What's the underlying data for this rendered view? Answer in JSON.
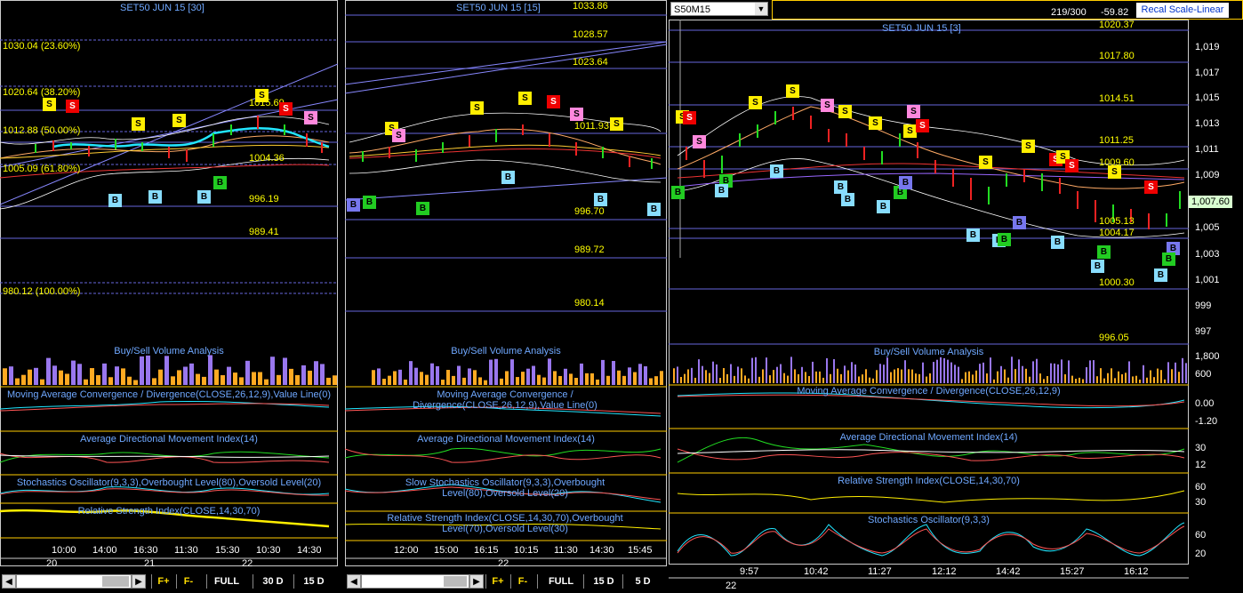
{
  "panels": [
    {
      "title": "SET50 JUN 15  [30]",
      "levels": [
        "1030.04 (23.60%)",
        "1020.64 (38.20%)",
        "1012.88 (50.00%)",
        "1005.09 (61.80%)",
        "980.12 (100.00%)",
        "1015.69",
        "1004.36",
        "996.19",
        "989.41"
      ],
      "indicators": [
        "Buy/Sell Volume Analysis",
        "Moving Average Convergence / Divergence(CLOSE,26,12,9),Value Line(0)",
        "Average Directional Movement Index(14)",
        "Stochastics Oscillator(9,3,3),Overbought Level(80),Oversold Level(20)",
        "Relative Strength Index(CLOSE,14,30,70)"
      ],
      "times": [
        "10:00",
        "14:00",
        "16:30",
        "11:30",
        "15:30",
        "10:30",
        "14:30"
      ],
      "dates": [
        "20",
        "21",
        "22"
      ],
      "buttons": [
        "F+",
        "F-",
        "FULL",
        "30 D",
        "15 D"
      ]
    },
    {
      "title": "SET50 JUN 15  [15]",
      "levels": [
        "1033.86",
        "1028.57",
        "1023.64",
        "1011.93",
        "996.70",
        "989.72",
        "980.14"
      ],
      "indicators": [
        "Buy/Sell Volume Analysis",
        "Moving Average Convergence / Divergence(CLOSE,26,12,9),Value Line(0)",
        "Average Directional Movement Index(14)",
        "Slow Stochastics Oscillator(9,3,3),Overbought Level(80),Oversold Level(20)",
        "Relative Strength Index(CLOSE,14,30,70),Overbought Level(70),Oversold Level(30)"
      ],
      "times": [
        "12:00",
        "15:00",
        "16:15",
        "10:15",
        "11:30",
        "14:30",
        "15:45"
      ],
      "dates": [
        "22"
      ],
      "buttons": [
        "F+",
        "F-",
        "FULL",
        "15 D",
        "5 D"
      ]
    },
    {
      "title": "SET50 JUN 15  [3]",
      "symbol": "S50M15",
      "counter": "219/300",
      "change": "-59.82",
      "scale_button": "Recal Scale-Linear",
      "levels": [
        "1020.37",
        "1017.80",
        "1014.51",
        "1011.25",
        "1009.60",
        "1005.13",
        "1004.17",
        "1000.30",
        "996.05"
      ],
      "last_price": "1,007.60",
      "price_axis": [
        "1,019",
        "1,017",
        "1,015",
        "1,013",
        "1,011",
        "1,009",
        "1,005",
        "1,003",
        "1,001",
        "999",
        "997"
      ],
      "volume_axis": [
        "1,800",
        "600"
      ],
      "macd_axis": [
        "0.00",
        "-1.20"
      ],
      "adx_axis": [
        "30",
        "12"
      ],
      "rsi_axis": [
        "60",
        "30"
      ],
      "stoch_axis": [
        "60",
        "20"
      ],
      "indicators": [
        "Buy/Sell Volume Analysis",
        "Moving Average Convergence / Divergence(CLOSE,26,12,9)",
        "Average Directional Movement Index(14)",
        "Relative Strength Index(CLOSE,14,30,70)",
        "Stochastics Oscillator(9,3,3)"
      ],
      "times": [
        "9:57",
        "10:42",
        "11:27",
        "12:12",
        "14:42",
        "15:27",
        "16:12"
      ],
      "dates": [
        "22"
      ]
    }
  ],
  "colors": {
    "level": "#ffff00",
    "title": "#6fa8ff",
    "up": "#22dd22",
    "down": "#ee2222",
    "grid_line": "#5555cc"
  }
}
